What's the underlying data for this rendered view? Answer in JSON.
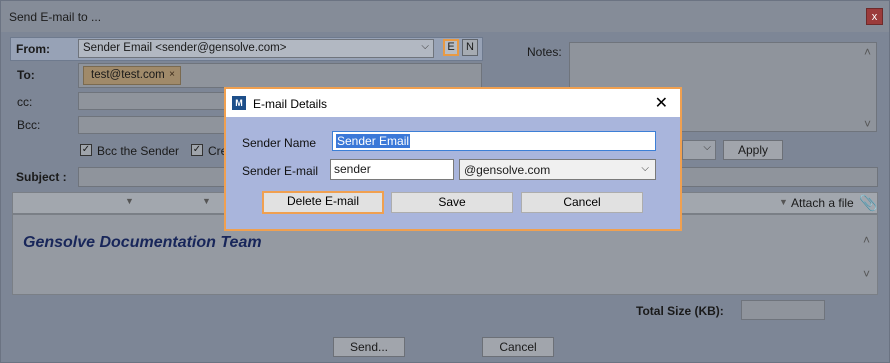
{
  "window": {
    "title": "Send E-mail to ...",
    "close_glyph": "x"
  },
  "from": {
    "label": "From:",
    "value": "Sender Email <sender@gensolve.com>",
    "e_button": "E",
    "n_button": "N"
  },
  "to": {
    "label": "To:",
    "recipient": "test@test.com",
    "remove_glyph": "×"
  },
  "cc": {
    "label": "cc:"
  },
  "bcc": {
    "label": "Bcc:"
  },
  "options": {
    "bcc_sender": "Bcc the Sender",
    "cre_partial": "Cre"
  },
  "notes": {
    "label": "Notes:"
  },
  "apply_button": "Apply",
  "subject": {
    "label": "Subject :"
  },
  "attach_label": "Attach a file",
  "signature": "Gensolve Documentation Team",
  "total_size": {
    "label": "Total Size (KB):"
  },
  "footer": {
    "send": "Send...",
    "cancel": "Cancel"
  },
  "dialog": {
    "title": "E-mail Details",
    "close_glyph": "✕",
    "sender_name_label": "Sender Name",
    "sender_name_value": "Sender Email",
    "sender_email_label": "Sender E-mail",
    "sender_email_value": "sender",
    "domain_value": "@gensolve.com",
    "delete_button": "Delete E-mail",
    "save_button": "Save",
    "cancel_button": "Cancel"
  },
  "colors": {
    "highlight": "#f0a050",
    "selection": "#3b78d8"
  }
}
